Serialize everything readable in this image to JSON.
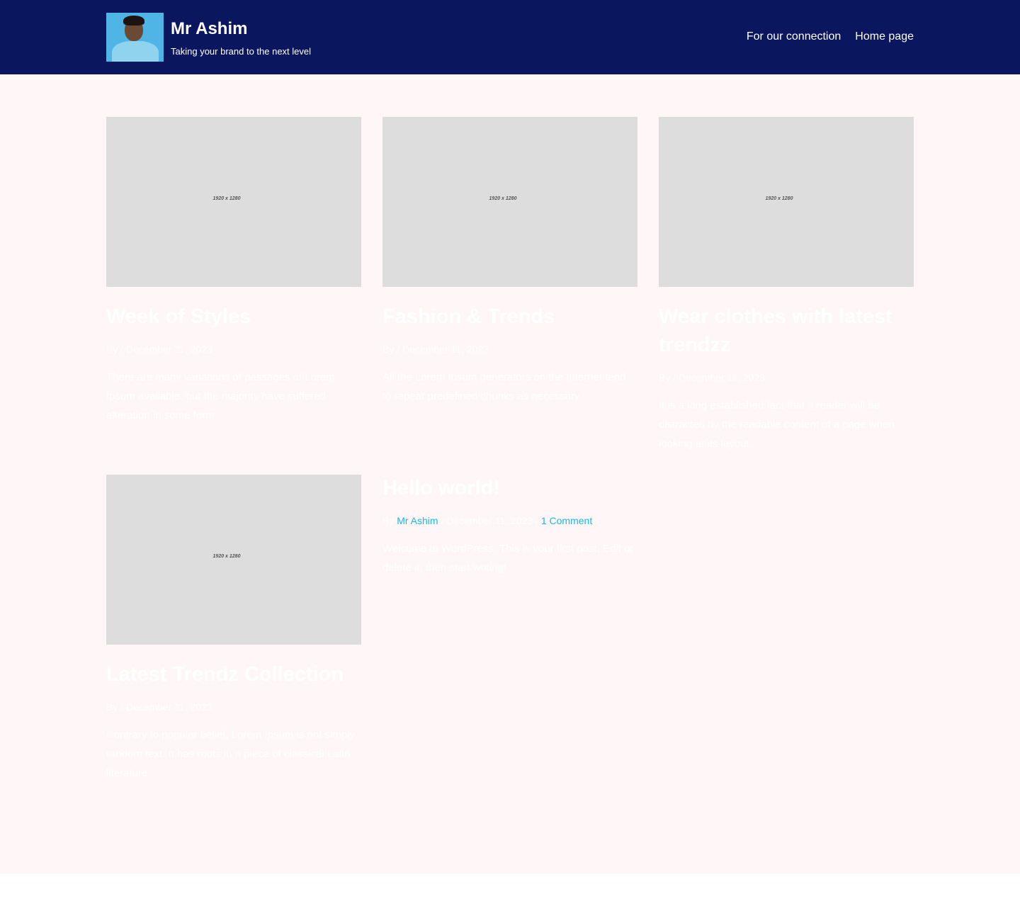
{
  "header": {
    "site_title": "Mr Ashim",
    "tagline": "Taking your brand to the next level",
    "nav": [
      "For our connection",
      "Home page"
    ]
  },
  "posts": [
    {
      "thumb": "1920 x 1280",
      "title": "Week of Styles",
      "by": "By",
      "sep": "/",
      "date": "December 11, 2023",
      "excerpt": "There are many variations of passages of Lorem Ipsum available, but the majority have suffered alteration in some form"
    },
    {
      "thumb": "1920 x 1280",
      "title": "Fashion & Trends",
      "by": "By",
      "sep": "/",
      "date": "December 11, 2023",
      "excerpt": "All the Lorem Ipsum generators on the Internet tend to repeat predefined chunks as necessary"
    },
    {
      "thumb": "1920 x 1280",
      "title": "Wear clothes with latest trendzz",
      "by": "By",
      "sep": "/",
      "date": "December 11, 2023",
      "excerpt": "It is a long established fact that a reader will be distracted by the readable content of a page when looking at its layout."
    },
    {
      "thumb": "1920 x 1280",
      "title": "Latest Trendz Collection",
      "by": "By",
      "sep": "/",
      "date": "December 11, 2023",
      "excerpt": "Contrary to popular belief, Lorem Ipsum is not simply random text. It has roots in a piece of classical Latin literature"
    },
    {
      "title": "Hello world!",
      "by": "By",
      "author": "Mr Ashim",
      "sep": "/",
      "date": "December 11, 2023",
      "comments": "1 Comment",
      "excerpt": "Welcome to WordPress. This is your first post. Edit or delete it, then start writing!"
    }
  ],
  "colors": {
    "header_bg": "#0a165e",
    "page_bg": "#fff7f7",
    "link": "#1ab7ea"
  }
}
